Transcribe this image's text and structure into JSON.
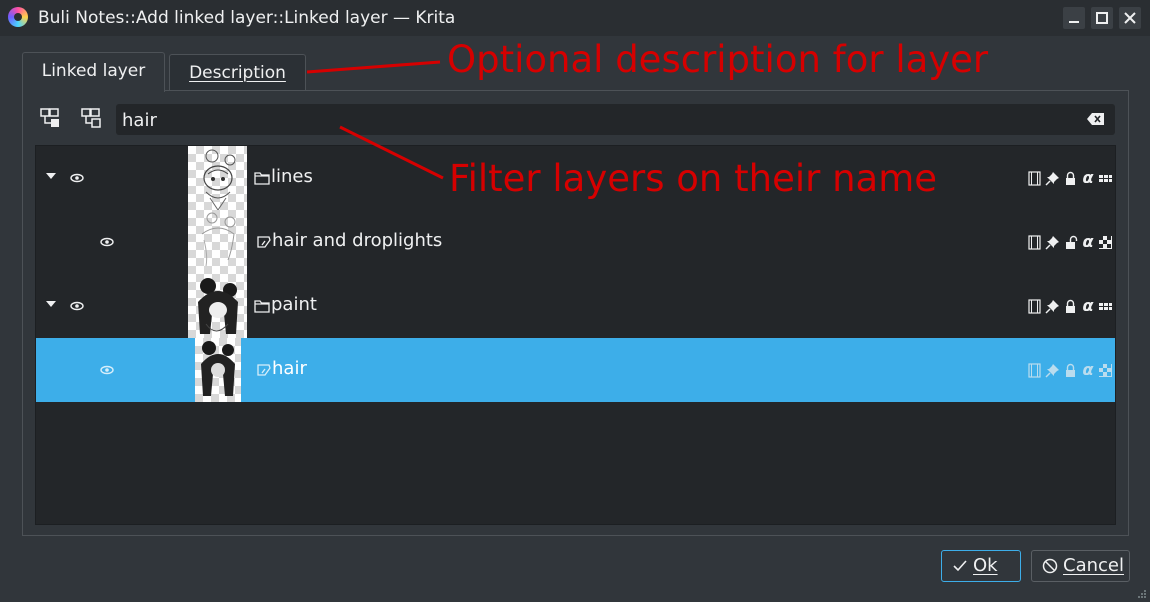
{
  "window": {
    "title": "Buli Notes::Add linked layer::Linked layer — Krita",
    "controls": [
      "minimize",
      "maximize",
      "close"
    ]
  },
  "tabs": [
    {
      "label": "Linked layer",
      "active": true
    },
    {
      "label": "Description",
      "active": false
    }
  ],
  "toolbar": {
    "buttons": [
      "expand-all-icon",
      "collapse-all-icon"
    ]
  },
  "filter": {
    "value": "hair"
  },
  "layers": [
    {
      "name": "lines",
      "type": "group",
      "expandable": true,
      "visible": true,
      "selected": false
    },
    {
      "name": "hair and droplights",
      "type": "paint",
      "expandable": false,
      "visible": true,
      "selected": false
    },
    {
      "name": "paint",
      "type": "group",
      "expandable": true,
      "visible": true,
      "selected": false
    },
    {
      "name": "hair",
      "type": "paint",
      "expandable": false,
      "visible": true,
      "selected": true
    }
  ],
  "annotations": [
    {
      "text": "Optional description for layer",
      "color": "#d60000"
    },
    {
      "text": "Filter layers on their name",
      "color": "#d60000"
    }
  ],
  "buttons": {
    "ok": "Ok",
    "cancel": "Cancel"
  },
  "colors": {
    "selection": "#3daee9",
    "background": "#31363b",
    "list_background": "#232629",
    "annotation": "#d60000"
  }
}
